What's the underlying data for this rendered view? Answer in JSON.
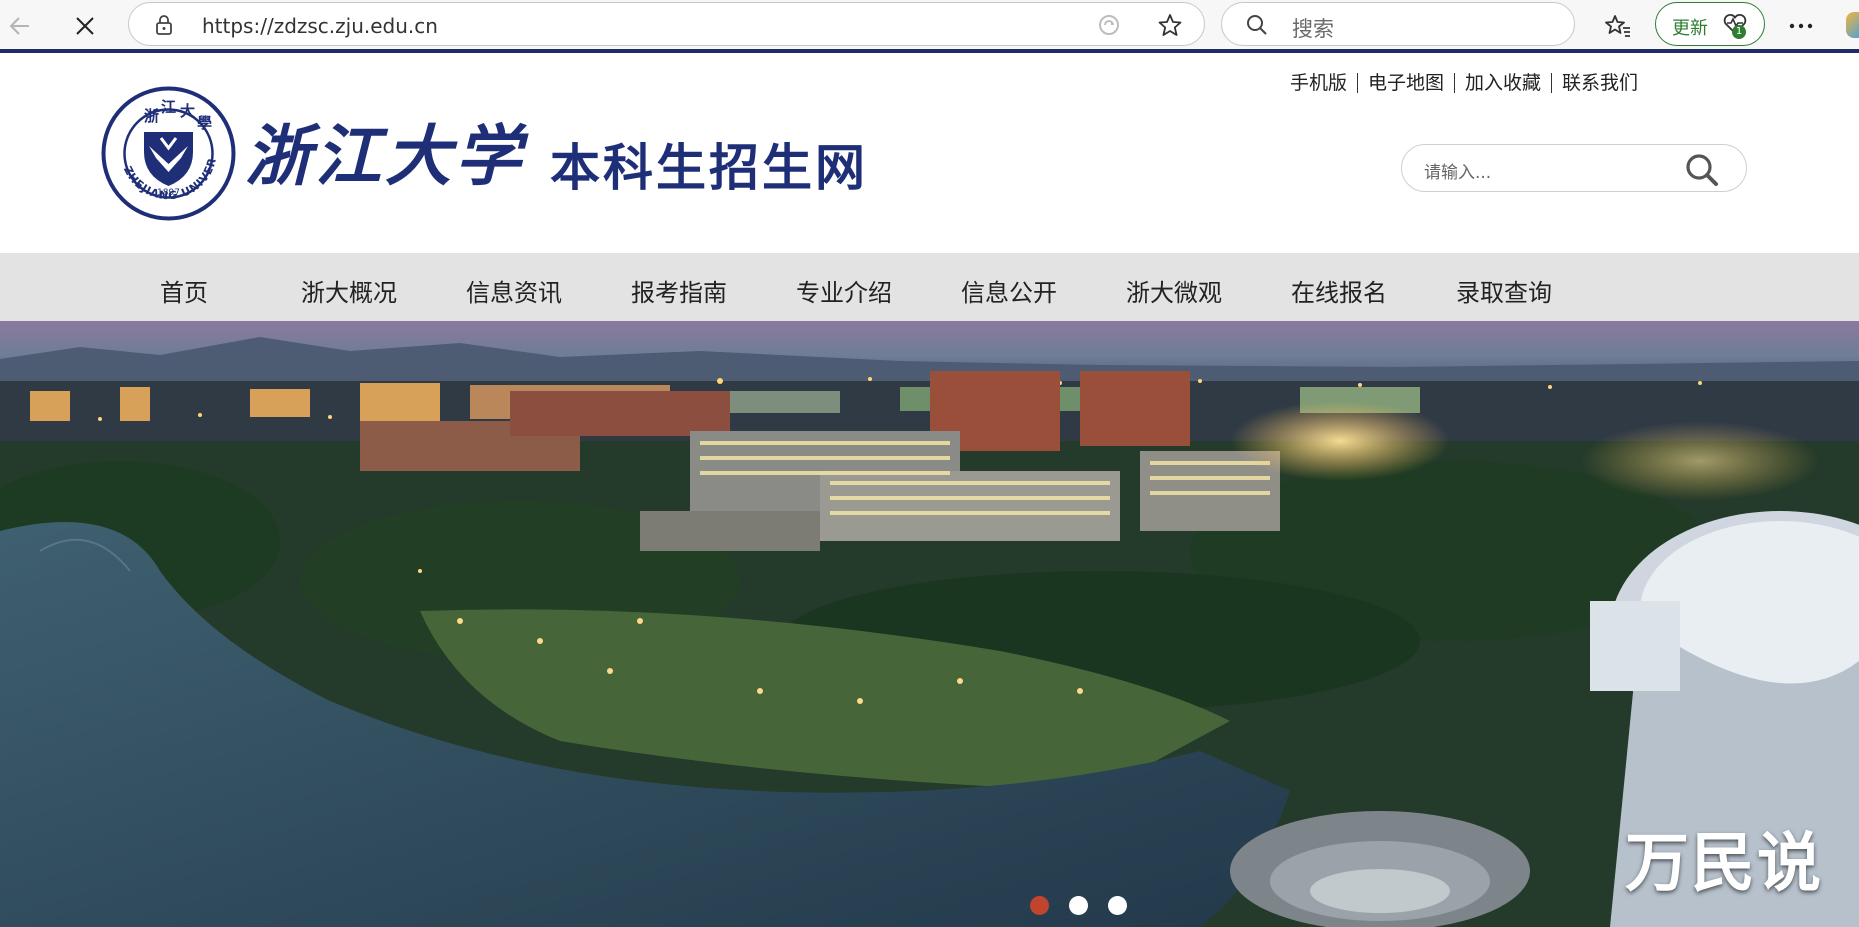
{
  "browser": {
    "url": "https://zdzsc.zju.edu.cn",
    "search_placeholder": "搜索",
    "update_label": "更新",
    "update_badge": "1"
  },
  "header": {
    "site_title": "浙江大学",
    "site_subtitle": "本科生招生网",
    "emblem_year": "1897",
    "emblem_text": "ZHEJIANG UNIVERSITY",
    "top_links": [
      "手机版",
      "电子地图",
      "加入收藏",
      "联系我们"
    ],
    "search_placeholder": "请输入..."
  },
  "nav": {
    "items": [
      "首页",
      "浙大概况",
      "信息资讯",
      "报考指南",
      "专业介绍",
      "信息公开",
      "浙大微观",
      "在线报名",
      "录取查询"
    ]
  },
  "banner": {
    "slide_count": 3,
    "active_slide": 1,
    "watermark": "万民说"
  },
  "colors": {
    "brand_blue": "#1e2f78",
    "nav_bg": "#e3e3e3",
    "active_dot": "#c0442e",
    "update_green": "#2e7d32"
  }
}
